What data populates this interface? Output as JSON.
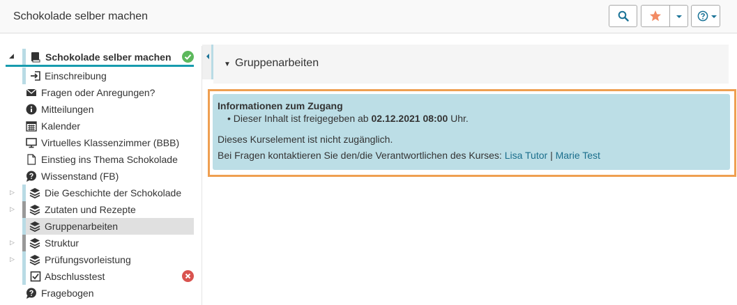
{
  "header": {
    "title": "Schokolade selber machen",
    "icons": [
      "search-icon",
      "star-icon",
      "caret-down-icon",
      "help-icon"
    ],
    "star_color": "#f28b64",
    "button_color": "#1a7397"
  },
  "sidebar": {
    "root": {
      "label": "Schokolade selber machen",
      "status": "check-circle-icon",
      "status_color": "#5cb85c"
    },
    "items": [
      {
        "label": "Einschreibung",
        "icon": "enrollment-icon"
      },
      {
        "label": "Fragen oder Anregungen?",
        "icon": "envelope-icon"
      },
      {
        "label": "Mitteilungen",
        "icon": "info-circle-icon"
      },
      {
        "label": "Kalender",
        "icon": "calendar-icon"
      },
      {
        "label": "Virtuelles Klassenzimmer (BBB)",
        "icon": "monitor-icon"
      },
      {
        "label": "Einstieg ins Thema Schokolade",
        "icon": "document-icon"
      },
      {
        "label": "Wissenstand (FB)",
        "icon": "question-bubble-icon"
      },
      {
        "label": "Die Geschichte der Schokolade",
        "icon": "layers-icon"
      },
      {
        "label": "Zutaten und Rezepte",
        "icon": "layers-icon"
      },
      {
        "label": "Gruppenarbeiten",
        "icon": "layers-icon"
      },
      {
        "label": "Struktur",
        "icon": "layers-icon"
      },
      {
        "label": "Prüfungsvorleistung",
        "icon": "layers-icon"
      },
      {
        "label": "Abschlusstest",
        "icon": "checkbox-icon",
        "status": "error-circle-icon",
        "status_color": "#d9534f"
      },
      {
        "label": "Fragebogen",
        "icon": "question-bubble-icon"
      }
    ]
  },
  "main": {
    "panel_title": "Gruppenarbeiten",
    "info": {
      "heading": "Informationen zum Zugang",
      "bullet_prefix": "Dieser Inhalt ist freigegeben ab",
      "bullet_date": "02.12.2021 08:00",
      "bullet_suffix": "Uhr.",
      "line1": "Dieses Kurselement ist nicht zugänglich.",
      "line2": "Bei Fragen kontaktieren Sie den/die Verantwortlichen des Kurses:",
      "contacts": [
        "Lisa Tutor",
        "Marie Test"
      ],
      "separator": "|",
      "box_color": "#bcdee6",
      "frame_color": "#ef9f51"
    }
  }
}
